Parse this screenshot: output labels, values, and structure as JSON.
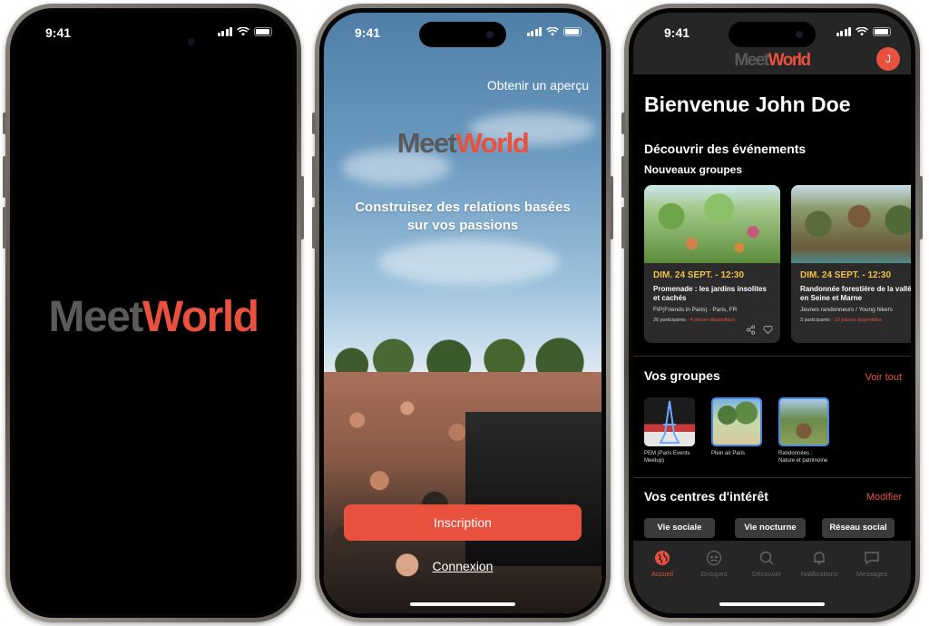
{
  "status": {
    "time": "9:41"
  },
  "brand": {
    "part1": "Meet",
    "part2": "World"
  },
  "onboarding": {
    "preview_link": "Obtenir un aperçu",
    "tagline_line1": "Construisez des relations basées",
    "tagline_line2": "sur vos passions",
    "signup_label": "Inscription",
    "login_label": "Connexion"
  },
  "home": {
    "avatar_initial": "J",
    "welcome": "Bienvenue John Doe",
    "discover_title": "Découvrir des événements",
    "new_groups_title": "Nouveaux groupes",
    "events": [
      {
        "date": "DIM. 24 SEPT. - 12:30",
        "title": "Promenade : les jardins insolites et cachés",
        "organizer": "FIP(Friends in Paris) · Paris, FR",
        "participants": "26 participants",
        "spots": "4 places disponibles"
      },
      {
        "date": "DIM. 24 SEPT. - 12:30",
        "title": "Randonnée forestière de la vallée en Seine et Marne",
        "organizer": "Jeunes randonneurs / Young hikers",
        "participants": "3 participants",
        "spots": "10 places disponibles"
      }
    ],
    "groups_title": "Vos groupes",
    "see_all": "Voir tout",
    "groups": [
      {
        "name": "PEM (Paris Events Meetup)"
      },
      {
        "name": "Plein air Paris"
      },
      {
        "name": "Randonnées : Nature et patrimoine"
      }
    ],
    "interests_title": "Vos centres d'intérêt",
    "edit": "Modifier",
    "interests": [
      "Vie sociale",
      "Vie nocturne",
      "Réseau social"
    ],
    "tabs": [
      {
        "label": "Accueil",
        "icon": "globe-icon"
      },
      {
        "label": "Groupes",
        "icon": "groups-icon"
      },
      {
        "label": "Découvrir",
        "icon": "search-icon"
      },
      {
        "label": "Notifications",
        "icon": "bell-icon"
      },
      {
        "label": "Messages",
        "icon": "message-icon"
      }
    ]
  },
  "colors": {
    "accent": "#e8513e",
    "date": "#f2c24a",
    "bg": "#131313"
  }
}
